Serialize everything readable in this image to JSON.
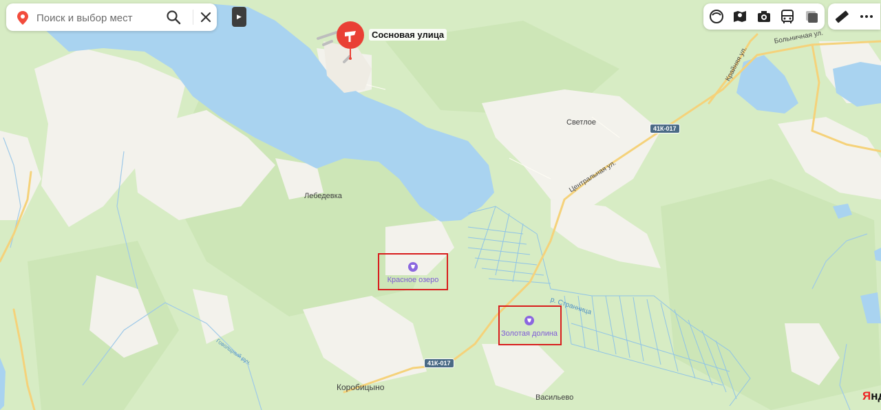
{
  "search": {
    "placeholder": "Поиск и выбор мест"
  },
  "placemark": {
    "label": "Сосновая улица"
  },
  "places": {
    "svetloe": "Светлое",
    "lebedevka": "Лебедевка",
    "korobitsyno": "Коробицыно",
    "vasilevo": "Васильево"
  },
  "poi": {
    "krasnoe_ozero": "Красное озеро",
    "zolotaya_dolina": "Золотая долина"
  },
  "roads": {
    "shield_top": "41К-017",
    "shield_bottom": "41К-017",
    "tsentralnaya": "Центральная ул.",
    "krainyaya": "Крайняя ул.",
    "bolnichnaya": "Больничная ул.",
    "strannitsa": "р. Странница",
    "govolyanyi": "Говолщный руч."
  },
  "toolbar": {
    "icons": [
      "layers-icon",
      "panorama-icon",
      "camera-icon",
      "bus-icon",
      "map-style-icon"
    ],
    "extra_icons": [
      "ruler-icon",
      "more-icon"
    ]
  },
  "brand": {
    "text": "Янд"
  },
  "colors": {
    "forest": "#d7ecc4",
    "open_land": "#f2f1ec",
    "water": "#a9d3f0",
    "road": "#f5d27a",
    "highlight": "#d81c1c",
    "poi": "#7d5ad6",
    "placemark": "#e94035"
  }
}
